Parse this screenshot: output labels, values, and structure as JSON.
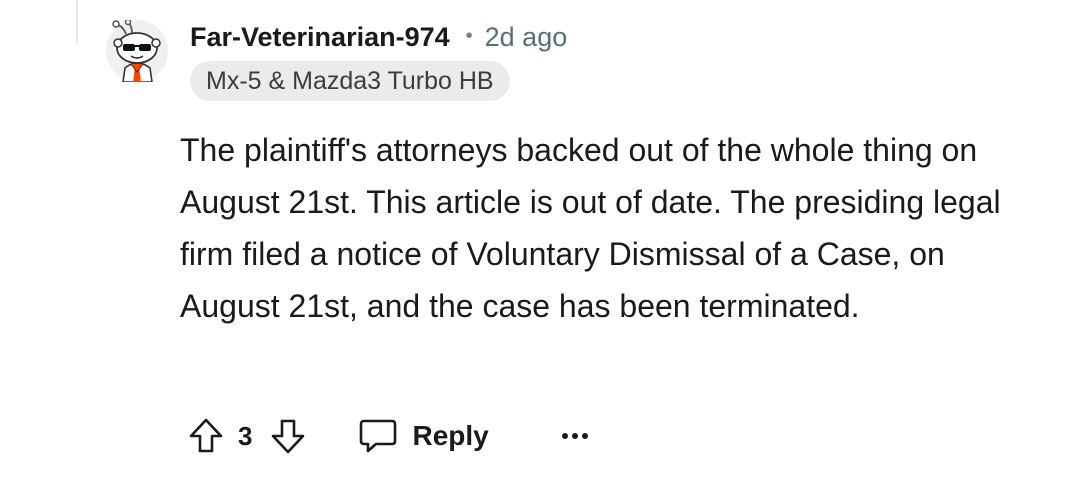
{
  "comment": {
    "username": "Far-Veterinarian-974",
    "separator": "•",
    "time_ago": "2d ago",
    "flair": "Mx-5 & Mazda3 Turbo HB",
    "body": "The plaintiff's attorneys backed out of the whole thing on August 21st. This article is out of date. The presiding legal firm filed a notice of Voluntary Dismissal of a Case, on August 21st, and the case has been terminated."
  },
  "actions": {
    "score": "3",
    "reply_label": "Reply",
    "more_label": "•••"
  },
  "icons": {
    "upvote": "arrow-up-outline-icon",
    "downvote": "arrow-down-outline-icon",
    "reply": "speech-bubble-icon",
    "more": "ellipsis-icon",
    "avatar": "snoo-avatar-with-sunglasses"
  },
  "colors": {
    "text": "#1a1a1b",
    "meta": "#576f76",
    "flair_bg": "#e9ebec"
  }
}
